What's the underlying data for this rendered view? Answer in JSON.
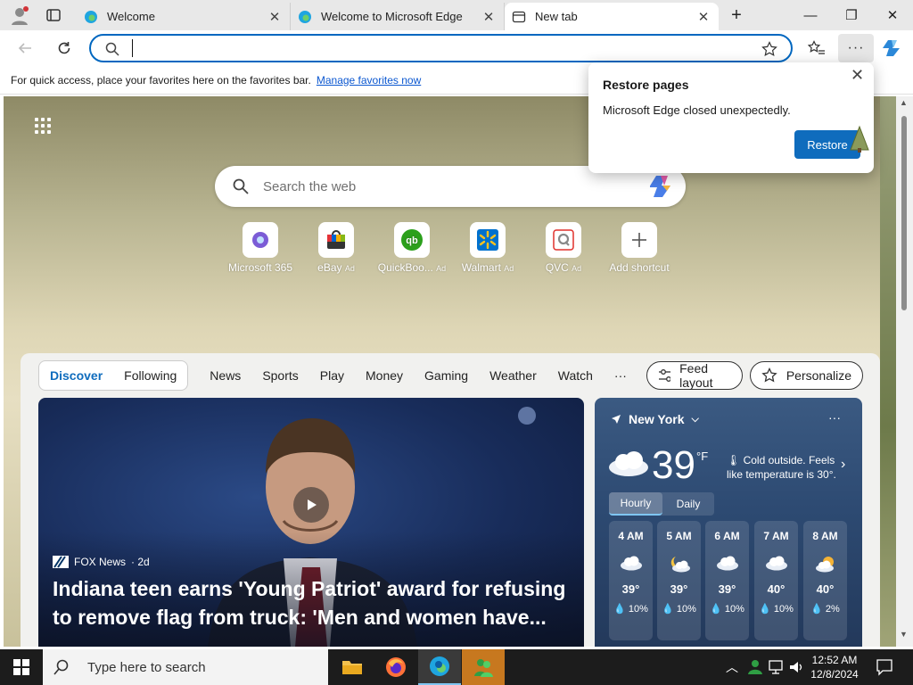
{
  "browser": {
    "tabs": [
      {
        "title": "Welcome",
        "icon": "edge-icon"
      },
      {
        "title": "Welcome to Microsoft Edge",
        "icon": "edge-icon"
      },
      {
        "title": "New tab",
        "icon": "newtab-icon",
        "active": true
      }
    ],
    "window_controls": {
      "new_tab": "+",
      "minimize": "—",
      "restore": "❐",
      "close": "✕"
    },
    "address_bar": {
      "value": "",
      "placeholder": ""
    },
    "favorites_bar": {
      "text": "For quick access, place your favorites here on the favorites bar.",
      "link": "Manage favorites now"
    }
  },
  "popup": {
    "title": "Restore pages",
    "message": "Microsoft Edge closed unexpectedly.",
    "button": "Restore"
  },
  "newtab": {
    "search_placeholder": "Search the web",
    "shortcuts": [
      {
        "label": "Microsoft 365",
        "ad": false,
        "icon": "m365-icon",
        "color": "#7b5cd6"
      },
      {
        "label": "eBay",
        "ad": true,
        "icon": "ebay-icon",
        "color": "#e53238"
      },
      {
        "label": "QuickBoo...",
        "ad": true,
        "icon": "quickbooks-icon",
        "color": "#2ca01c"
      },
      {
        "label": "Walmart",
        "ad": true,
        "icon": "walmart-icon",
        "color": "#0071ce"
      },
      {
        "label": "QVC",
        "ad": true,
        "icon": "qvc-icon",
        "color": "#e0302b"
      },
      {
        "label": "Add shortcut",
        "ad": false,
        "icon": "add-icon",
        "color": "#555555"
      }
    ],
    "ad_label": "Ad"
  },
  "feed": {
    "tabs": [
      "Discover",
      "Following"
    ],
    "active_tab": "Discover",
    "categories": [
      "News",
      "Sports",
      "Play",
      "Money",
      "Gaming",
      "Weather",
      "Watch"
    ],
    "more": "···",
    "feed_layout": "Feed layout",
    "personalize": "Personalize",
    "article": {
      "source": "FOX News",
      "age": "· 2d",
      "headline": "Indiana teen earns 'Young Patriot' award for refusing to remove flag from truck: 'Men and women have..."
    }
  },
  "weather": {
    "location": "New York",
    "temp": "39",
    "unit": "°F",
    "summary": "Cold outside. Feels like temperature is 30°.",
    "tabs": [
      "Hourly",
      "Daily"
    ],
    "hourly": [
      {
        "time": "4 AM",
        "temp": "39°",
        "precip": "10%",
        "icon": "cloud-icon"
      },
      {
        "time": "5 AM",
        "temp": "39°",
        "precip": "10%",
        "icon": "moon-cloud-icon"
      },
      {
        "time": "6 AM",
        "temp": "39°",
        "precip": "10%",
        "icon": "cloud-icon"
      },
      {
        "time": "7 AM",
        "temp": "40°",
        "precip": "10%",
        "icon": "cloud-icon"
      },
      {
        "time": "8 AM",
        "temp": "40°",
        "precip": "2%",
        "icon": "sun-cloud-icon"
      }
    ]
  },
  "taskbar": {
    "search_placeholder": "Type here to search",
    "time": "12:52 AM",
    "date": "12/8/2024"
  }
}
